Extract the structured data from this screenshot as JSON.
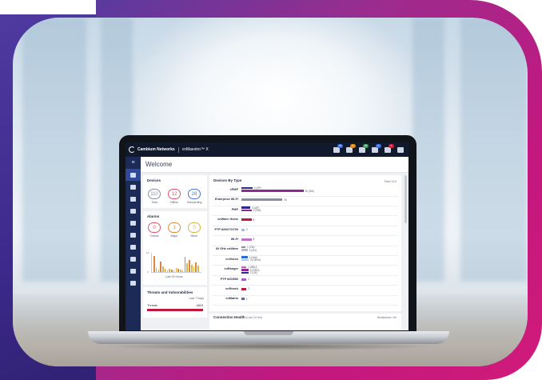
{
  "header": {
    "brand": "Cambium Networks",
    "product": "cnMaestro™ X",
    "icons": [
      {
        "name": "alerts-icon",
        "badge": "42",
        "color": "#3b6fe0"
      },
      {
        "name": "warning-icon",
        "badge": "4",
        "color": "#e08a1c"
      },
      {
        "name": "devices-icon",
        "badge": "28",
        "color": "#3b9e5a"
      },
      {
        "name": "chat-icon",
        "badge": "6",
        "color": "#3b6fe0"
      },
      {
        "name": "notifications-icon",
        "badge": "1",
        "color": "#d0223c"
      },
      {
        "name": "user-icon",
        "badge": "",
        "color": ""
      }
    ]
  },
  "welcome": "Welcome",
  "devices": {
    "title": "Devices",
    "items": [
      {
        "value": "110",
        "label": "Total",
        "color": "#8a8f9c"
      },
      {
        "value": "12",
        "label": "Offline",
        "color": "#d8576a"
      },
      {
        "value": "28",
        "label": "Onboarding",
        "color": "#4a74d8"
      }
    ]
  },
  "alarms": {
    "title": "Alarms",
    "items": [
      {
        "value": "0",
        "label": "Critical",
        "color": "#d8576a"
      },
      {
        "value": "1",
        "label": "Major",
        "color": "#e08a3c"
      },
      {
        "value": "0",
        "label": "Minor",
        "color": "#d9b64a"
      }
    ],
    "y_top": "12",
    "y_bottom": "0",
    "caption": "Last 24 Hours",
    "bars": [
      {
        "v": 0.9,
        "c": "#e0843a"
      },
      {
        "v": 0.25,
        "c": "#d9b64a"
      },
      {
        "v": 0.15,
        "c": "#d9b64a"
      },
      {
        "v": 0.6,
        "c": "#e0843a"
      },
      {
        "v": 0.3,
        "c": "#d9b64a"
      },
      {
        "v": 0.2,
        "c": "#e0843a"
      },
      {
        "v": 0.1,
        "c": "#d9b64a"
      },
      {
        "v": 0.2,
        "c": "#d9b64a"
      },
      {
        "v": 0.15,
        "c": "#e0843a"
      },
      {
        "v": 0.1,
        "c": "#d9b64a"
      },
      {
        "v": 0.25,
        "c": "#d9b64a"
      },
      {
        "v": 0.2,
        "c": "#e0843a"
      },
      {
        "v": 0.15,
        "c": "#d9b64a"
      },
      {
        "v": 0.1,
        "c": "#d9b64a"
      },
      {
        "v": 0.85,
        "c": "#e0843a"
      },
      {
        "v": 0.5,
        "c": "#d9b64a"
      },
      {
        "v": 0.7,
        "c": "#e0843a"
      },
      {
        "v": 0.4,
        "c": "#d9b64a"
      },
      {
        "v": 0.3,
        "c": "#d9b64a"
      },
      {
        "v": 0.55,
        "c": "#e0843a"
      },
      {
        "v": 0.35,
        "c": "#d9b64a"
      }
    ]
  },
  "threats": {
    "title": "Threats and Vulnerabilities",
    "subtitle": "Last 7 Days",
    "label": "Threats",
    "value": "4819"
  },
  "devices_by_type": {
    "title": "Devices By Type",
    "total": "Total 110",
    "rows": [
      {
        "label": "ePMP",
        "bars": [
          {
            "v": 0.11,
            "c": "#2b2a8c",
            "t": "4 (AP)"
          },
          {
            "v": 0.62,
            "c": "#8e2a8e",
            "t": "30 (SM)"
          }
        ]
      },
      {
        "label": "Enterprise Wi-Fi",
        "bars": [
          {
            "v": 0.41,
            "c": "#8a8f9c",
            "t": "26"
          }
        ]
      },
      {
        "label": "PMP",
        "bars": [
          {
            "v": 0.09,
            "c": "#2b2a8c",
            "t": "3 (AP)"
          },
          {
            "v": 0.1,
            "c": "#8e2a8e",
            "t": "1 (SM)"
          }
        ]
      },
      {
        "label": "cnWave Home",
        "bars": [
          {
            "v": 0.1,
            "c": "#c0183a",
            "t": "8"
          }
        ]
      },
      {
        "label": "PTP 820/670/700",
        "bars": [
          {
            "v": 0.03,
            "c": "#a9b6ea",
            "t": "3"
          }
        ]
      },
      {
        "label": "Wi-Fi",
        "bars": [
          {
            "v": 0.1,
            "c": "#c070c8",
            "t": "8"
          }
        ]
      },
      {
        "label": "60 GHz cnWave",
        "bars": [
          {
            "v": 0.04,
            "c": "#8a8f9c",
            "t": "1 (CN)"
          },
          {
            "v": 0.06,
            "c": "#b7bcc6",
            "t": "3 (DN)"
          }
        ]
      },
      {
        "label": "cnVision",
        "bars": [
          {
            "v": 0.06,
            "c": "#2a6bd8",
            "t": "2 (Hub)"
          },
          {
            "v": 0.07,
            "c": "#a9c8ee",
            "t": "3 (Client)"
          }
        ]
      },
      {
        "label": "cnRanger",
        "bars": [
          {
            "v": 0.05,
            "c": "#c060b8",
            "t": "1 (BBU)"
          },
          {
            "v": 0.07,
            "c": "#8e2a8e",
            "t": "5 (RRH)"
          },
          {
            "v": 0.07,
            "c": "#2b2a8c",
            "t": "1 (UE)"
          }
        ]
      },
      {
        "label": "PTP 820/850",
        "bars": [
          {
            "v": 0.05,
            "c": "#a060c0",
            "t": "2"
          }
        ]
      },
      {
        "label": "cnReach",
        "bars": [
          {
            "v": 0.05,
            "c": "#c0183a",
            "t": "2"
          }
        ]
      },
      {
        "label": "cnMatrix",
        "bars": [
          {
            "v": 0.03,
            "c": "#5a6a9c",
            "t": "1"
          }
        ]
      }
    ]
  },
  "connection": {
    "title": "Connection Health",
    "range": "(Last 24 Hrs)",
    "breakdown": "Breakdown: Hb"
  }
}
